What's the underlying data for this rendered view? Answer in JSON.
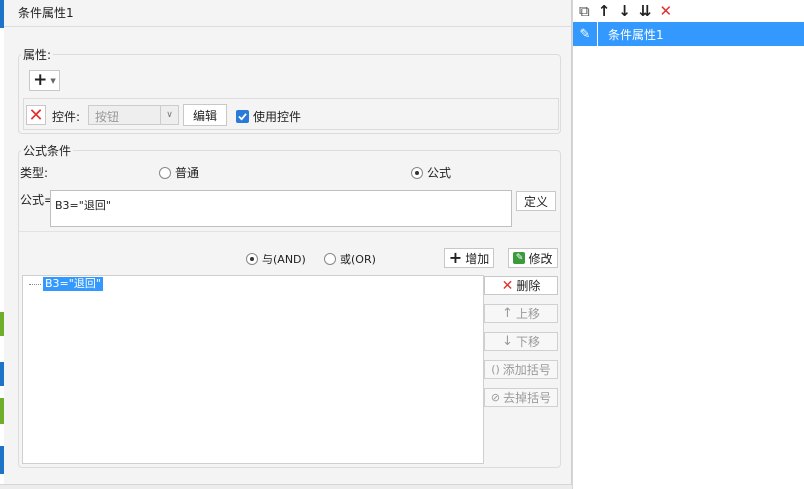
{
  "dialog": {
    "title": "条件属性1"
  },
  "property_group": {
    "legend": "属性:",
    "add_button": "+",
    "control_label": "控件:",
    "control_select_value": "按钮",
    "edit_button": "编辑",
    "use_control_label": "使用控件",
    "use_control_checked": true
  },
  "formula_group": {
    "legend": "公式条件",
    "type_label": "类型:",
    "type_options": [
      "普通",
      "公式"
    ],
    "type_selected": "公式",
    "formula_label": "公式=",
    "formula_value": "B3=\"退回\"",
    "define_button": "定义",
    "logic_options": [
      "与(AND)",
      "或(OR)"
    ],
    "logic_selected": "与(AND)",
    "add_button": "增加",
    "modify_button": "修改",
    "tree_items": [
      "B3=\"退回\""
    ],
    "side_buttons": {
      "delete": "删除",
      "move_up": "上移",
      "move_down": "下移",
      "add_bracket": "添加括号",
      "remove_bracket": "去掉括号"
    }
  },
  "right_panel": {
    "toolbar": [
      "copy-icon",
      "arrow-up-icon",
      "arrow-down-icon",
      "move-bottom-icon",
      "delete-icon"
    ],
    "items": [
      "条件属性1"
    ],
    "selected_index": 0
  },
  "colors": {
    "selection": "#3399ff",
    "delete_red": "#e03030",
    "check_blue": "#2a7ad9"
  }
}
